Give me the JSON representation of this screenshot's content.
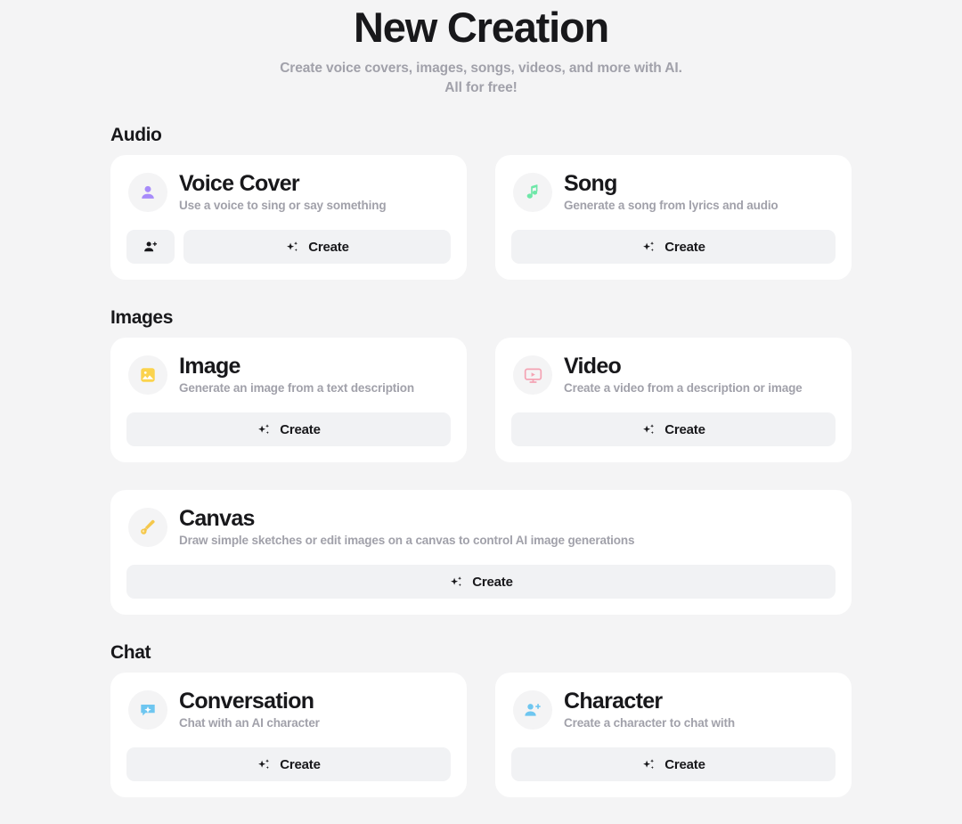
{
  "header": {
    "title": "New Creation",
    "subtitle_line1": "Create voice covers, images, songs, videos, and more with AI.",
    "subtitle_line2": "All for free!"
  },
  "colors": {
    "page_background": "#f4f4f5",
    "card_background": "#ffffff",
    "button_background": "#f1f2f4",
    "title_text": "#18181b",
    "muted_text": "#a1a1aa",
    "icon_voice_cover": "#a78bfa",
    "icon_song": "#6ee7a8",
    "icon_image": "#fbd34d",
    "icon_video": "#f4a3b4",
    "icon_canvas": "#f5c84c",
    "icon_conversation": "#6ec6f0",
    "icon_character": "#6ec6f0"
  },
  "sections": [
    {
      "heading": "Audio",
      "cards": [
        {
          "title": "Voice Cover",
          "description": "Use a voice to sing or say something",
          "icon": "person-icon",
          "create_label": "Create",
          "has_secondary": true,
          "secondary_icon": "person-add-icon"
        },
        {
          "title": "Song",
          "description": "Generate a song from lyrics and audio",
          "icon": "music-note-icon",
          "create_label": "Create",
          "has_secondary": false
        }
      ]
    },
    {
      "heading": "Images",
      "cards": [
        {
          "title": "Image",
          "description": "Generate an image from a text description",
          "icon": "picture-icon",
          "create_label": "Create",
          "has_secondary": false
        },
        {
          "title": "Video",
          "description": "Create a video from a description or image",
          "icon": "video-monitor-icon",
          "create_label": "Create",
          "has_secondary": false
        }
      ]
    },
    {
      "heading": "",
      "cards": [
        {
          "title": "Canvas",
          "description": "Draw simple sketches or edit images on a canvas to control AI image generations",
          "icon": "paintbrush-icon",
          "create_label": "Create",
          "has_secondary": false,
          "wide": true
        }
      ]
    },
    {
      "heading": "Chat",
      "cards": [
        {
          "title": "Conversation",
          "description": "Chat with an AI character",
          "icon": "chat-bubble-sparkle-icon",
          "create_label": "Create",
          "has_secondary": false
        },
        {
          "title": "Character",
          "description": "Create a character to chat with",
          "icon": "person-add-blue-icon",
          "create_label": "Create",
          "has_secondary": false
        }
      ]
    }
  ]
}
